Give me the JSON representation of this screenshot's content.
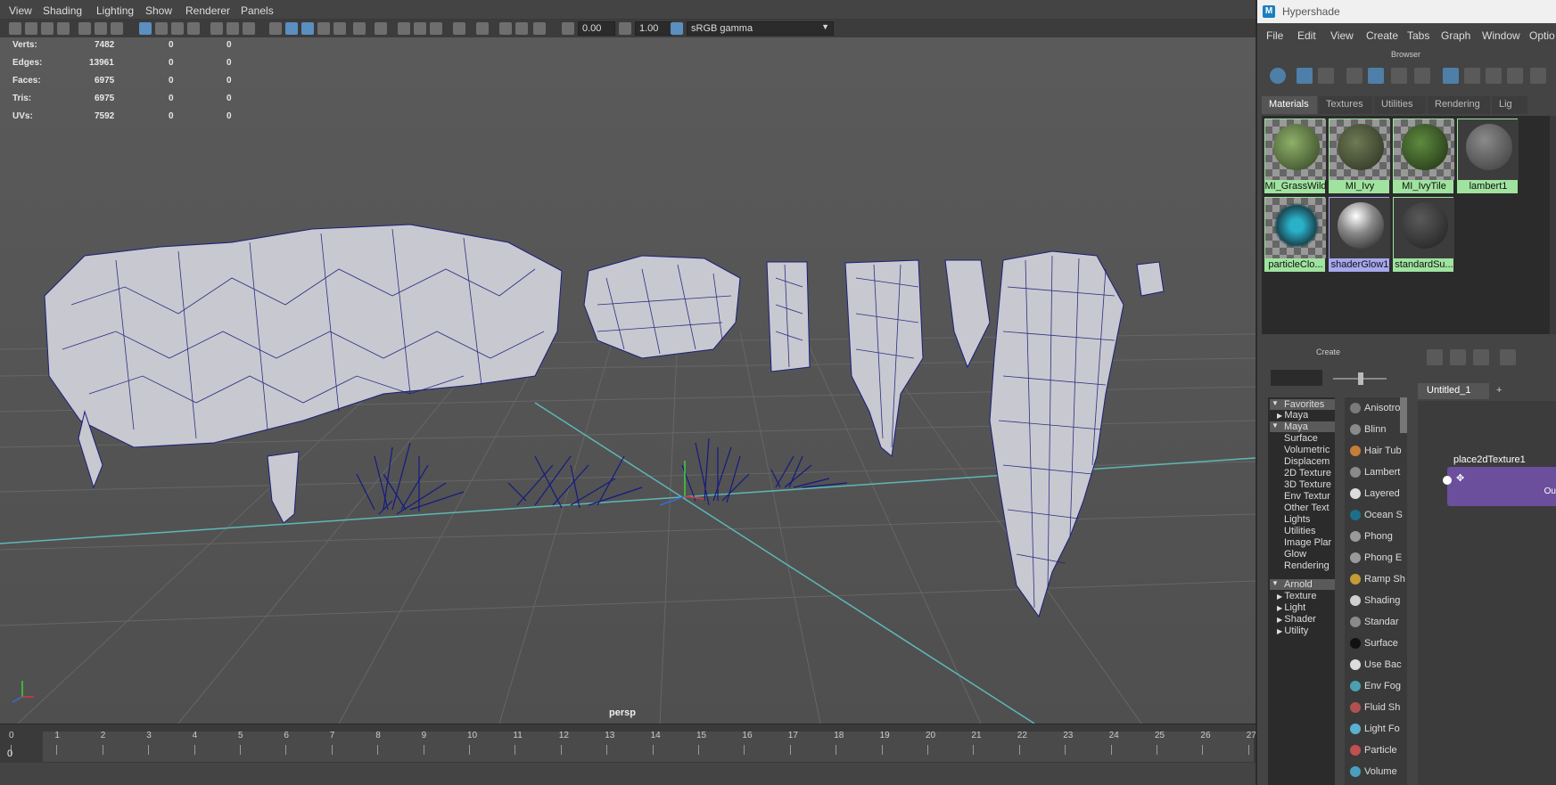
{
  "viewport": {
    "menu": [
      "View",
      "Shading",
      "Lighting",
      "Show",
      "Renderer",
      "Panels"
    ],
    "toolbar": {
      "exposure": "0.00",
      "gamma": "1.00",
      "color_space": "sRGB gamma"
    },
    "hud": {
      "rows": [
        {
          "label": "Verts:",
          "v1": "7482",
          "v2": "0",
          "v3": "0"
        },
        {
          "label": "Edges:",
          "v1": "13961",
          "v2": "0",
          "v3": "0"
        },
        {
          "label": "Faces:",
          "v1": "6975",
          "v2": "0",
          "v3": "0"
        },
        {
          "label": "Tris:",
          "v1": "6975",
          "v2": "0",
          "v3": "0"
        },
        {
          "label": "UVs:",
          "v1": "7592",
          "v2": "0",
          "v3": "0"
        }
      ]
    },
    "camera_label": "persp",
    "timeline": {
      "current_frame": "0",
      "frames": [
        "0",
        "1",
        "2",
        "3",
        "4",
        "5",
        "6",
        "7",
        "8",
        "9",
        "10",
        "11",
        "12",
        "13",
        "14",
        "15",
        "16",
        "17",
        "18",
        "19",
        "20",
        "21",
        "22",
        "23",
        "24",
        "25",
        "26",
        "27"
      ]
    },
    "colors": {
      "wire": "#1a1f7a",
      "mesh_fill": "#c8c8d0",
      "grid": "#6a6a6a",
      "axis": "#5fb7b7"
    }
  },
  "hypershade": {
    "title": "Hypershade",
    "logo": "M",
    "menu": [
      "File",
      "Edit",
      "View",
      "Create",
      "Tabs",
      "Graph",
      "Window",
      "Optio"
    ],
    "browser_label": "Browser",
    "tabs": [
      "Materials",
      "Textures",
      "Utilities",
      "Rendering",
      "Lig"
    ],
    "materials": [
      {
        "name": "MI_GrassWild",
        "style": "green"
      },
      {
        "name": "MI_Ivy",
        "style": "green"
      },
      {
        "name": "MI_IvyTile",
        "style": "green"
      },
      {
        "name": "lambert1",
        "style": "green"
      },
      {
        "name": "particleClo...",
        "style": "green"
      },
      {
        "name": "shaderGlow1",
        "style": "blue"
      },
      {
        "name": "standardSu...",
        "style": "green"
      }
    ],
    "create": {
      "label": "Create",
      "tree": {
        "favorites": "Favorites",
        "fav_maya": "Maya",
        "maya": "Maya",
        "maya_items": [
          "Surface",
          "Volumetric",
          "Displacem",
          "2D Texture",
          "3D Texture",
          "Env Textur",
          "Other Text",
          "Lights",
          "Utilities",
          "Image Plar",
          "Glow",
          "Rendering"
        ],
        "arnold": "Arnold",
        "arnold_items": [
          "Texture",
          "Light",
          "Shader",
          "Utility"
        ]
      },
      "nodes": [
        {
          "label": "Anisotro",
          "color": "#7a7a7a"
        },
        {
          "label": "Blinn",
          "color": "#8a8a8a"
        },
        {
          "label": "Hair Tub",
          "color": "#c67d3a"
        },
        {
          "label": "Lambert",
          "color": "#8a8a8a"
        },
        {
          "label": "Layered",
          "color": "#dcdcdc"
        },
        {
          "label": "Ocean S",
          "color": "#1b6f8a"
        },
        {
          "label": "Phong",
          "color": "#9a9a9a"
        },
        {
          "label": "Phong E",
          "color": "#9a9a9a"
        },
        {
          "label": "Ramp Sh",
          "color": "#c59b35"
        },
        {
          "label": "Shading",
          "color": "#cfcfcf"
        },
        {
          "label": "Standar",
          "color": "#8a8a8a"
        },
        {
          "label": "Surface",
          "color": "#111111"
        },
        {
          "label": "Use Bac",
          "color": "#dcdcdc"
        },
        {
          "label": "Env Fog",
          "color": "#4aa0b0"
        },
        {
          "label": "Fluid Sh",
          "color": "#b05050"
        },
        {
          "label": "Light Fo",
          "color": "#5ab0d0"
        },
        {
          "label": "Particle",
          "color": "#c05050"
        },
        {
          "label": "Volume",
          "color": "#4a9fbf"
        }
      ]
    },
    "graph": {
      "tab": "Untitled_1",
      "add_tab": "+",
      "node_name": "place2dTexture1",
      "node_port_label": "Ou"
    }
  }
}
